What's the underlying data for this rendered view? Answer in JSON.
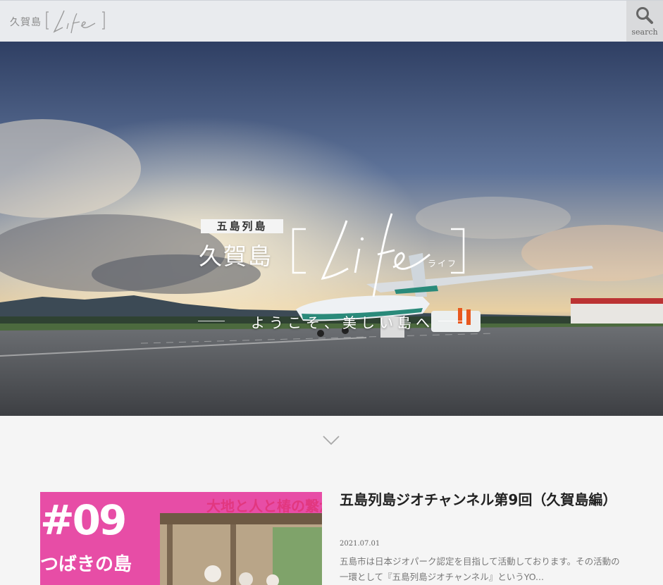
{
  "header": {
    "logo_kanji": "久賀島",
    "logo_script": "Life",
    "search_label": "search"
  },
  "hero": {
    "label": "五島列島",
    "kanji": "久賀島",
    "script": "Life",
    "kana": "ライフ",
    "tagline": "ようこそ、美しい島へ"
  },
  "article": {
    "thumb_number": "#09",
    "thumb_subtitle": "つばきの島",
    "thumb_banner": "大地と人と椿の繋がり",
    "title": "五島列島ジオチャンネル第9回（久賀島編）",
    "date": "2021.07.01",
    "excerpt": "五島市は日本ジオパーク認定を目指して活動しております。その活動の一環として『五島列島ジオチャンネル』というYO..."
  },
  "colors": {
    "header_bg": "#e9ebee",
    "thumb_pink": "#e74da6",
    "page_bg": "#f5f5f5"
  }
}
